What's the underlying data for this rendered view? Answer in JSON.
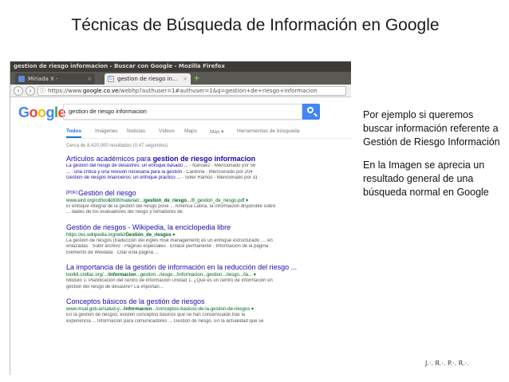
{
  "slide": {
    "title": "Técnicas de Búsqueda de Información en Google",
    "explanation": [
      "Por ejemplo si queremos buscar información referente a Gestión de Riesgo Información",
      "En la Imagen se aprecia un resultado general de una búsqueda normal en Google"
    ],
    "author": "J.·. R.·. P.·. R.·."
  },
  "browser": {
    "window_title": "gestion de riesgo informacion - Buscar con Google - Mozilla Firefox",
    "tabs": [
      {
        "label": "Miriada X -",
        "close": "×"
      },
      {
        "label": "gestion de riesgo in...",
        "close": "×"
      }
    ],
    "new_tab": "+",
    "url_prefix": "https://www.",
    "url_domain": "google.co.ve",
    "url_rest": "/webhp?authuser=1#authuser=1&q=gestion+de+riesgo+informacion"
  },
  "google": {
    "logo": {
      "G": "G",
      "o1": "o",
      "o2": "o",
      "g": "g",
      "l": "l",
      "e": "e"
    },
    "query": "gestion de riesgo informacion",
    "tabs": [
      "Todos",
      "Imágenes",
      "Noticias",
      "Videos",
      "Maps",
      "Más ▾",
      "Herramientas de búsqueda"
    ],
    "stats": "Cerca de 8,420,000 resultados (0.47 segundos)",
    "results": [
      {
        "title_pre": "Artículos académicos para ",
        "title_bold": "gestion de riesgo informacion",
        "lines": [
          {
            "a": "La gestión del riesgo de desastres: un enfoque basado ...",
            "b": " - Narváez - Mencionado por 56"
          },
          {
            "a": "... : una crítica y una revisión necesaria para la gestión",
            "b": " - Cardona - Mencionado por 204"
          },
          {
            "a": "Gestión de riesgos financieros: un enfoque práctico ...",
            "b": " - Soler Ramos - Mencionado por 31"
          }
        ]
      },
      {
        "pdf": "[PDF]",
        "title": "Gestión del riesgo",
        "url_pre": "www.eird.org/cd/toolkit08/material/.../",
        "url_bold": "gestion_de_riesgo",
        "url_post": ".../8_gestion_de_riesgo.pdf ▾",
        "snippet": [
          "El enfoque integral de la gestión del riesgo pone ... América Latina, la información disponible sobre",
          "... dades de los evaluadores del riesgo y tomadores de."
        ]
      },
      {
        "title": "Gestión de riesgos - Wikipedia, la enciclopedia libre",
        "url_pre": "https://es.wikipedia.org/wiki/",
        "url_bold": "Gestión_de_riesgos",
        "url_post": " ▾",
        "snippet": [
          "La gestión de riesgos (traducción del inglés Risk management) es un enfoque estructurado .... en",
          "enlazadas · Subir archivo · Páginas especiales · Enlace permanente · Información de la página ·",
          "Elemento de Wikidata · Citar esta página ..."
        ]
      },
      {
        "title": "La importancia de la gestión de información en la reducción del riesgo ...",
        "url_pre": "toolkit.cridlac.org/.../",
        "url_bold": "informacion",
        "url_post": "...gestion...riesgo.../informacion...gestion...riesgo.../la... ▾",
        "snippet": [
          "Módulo 1: Planificación del centro de información Unidad 1. ¿Qué es un centro de información en",
          "gestión del riesgo de desastre? La importan..."
        ]
      },
      {
        "title": "Conceptos básicos de la gestión de riesgos",
        "url_pre": "www.msal.gob.ar/salud-y.../",
        "url_bold": "informacion",
        "url_post": ".../conceptos-basicos-de-la-gestion-de-riesgos ▾",
        "snippet": [
          "En la gestión de riesgos, existen conceptos básicos que se han consensuado tras la",
          "experiencia ... Información para comunicadores ... Gestión de riesgo. En la actualidad que se"
        ]
      }
    ]
  }
}
